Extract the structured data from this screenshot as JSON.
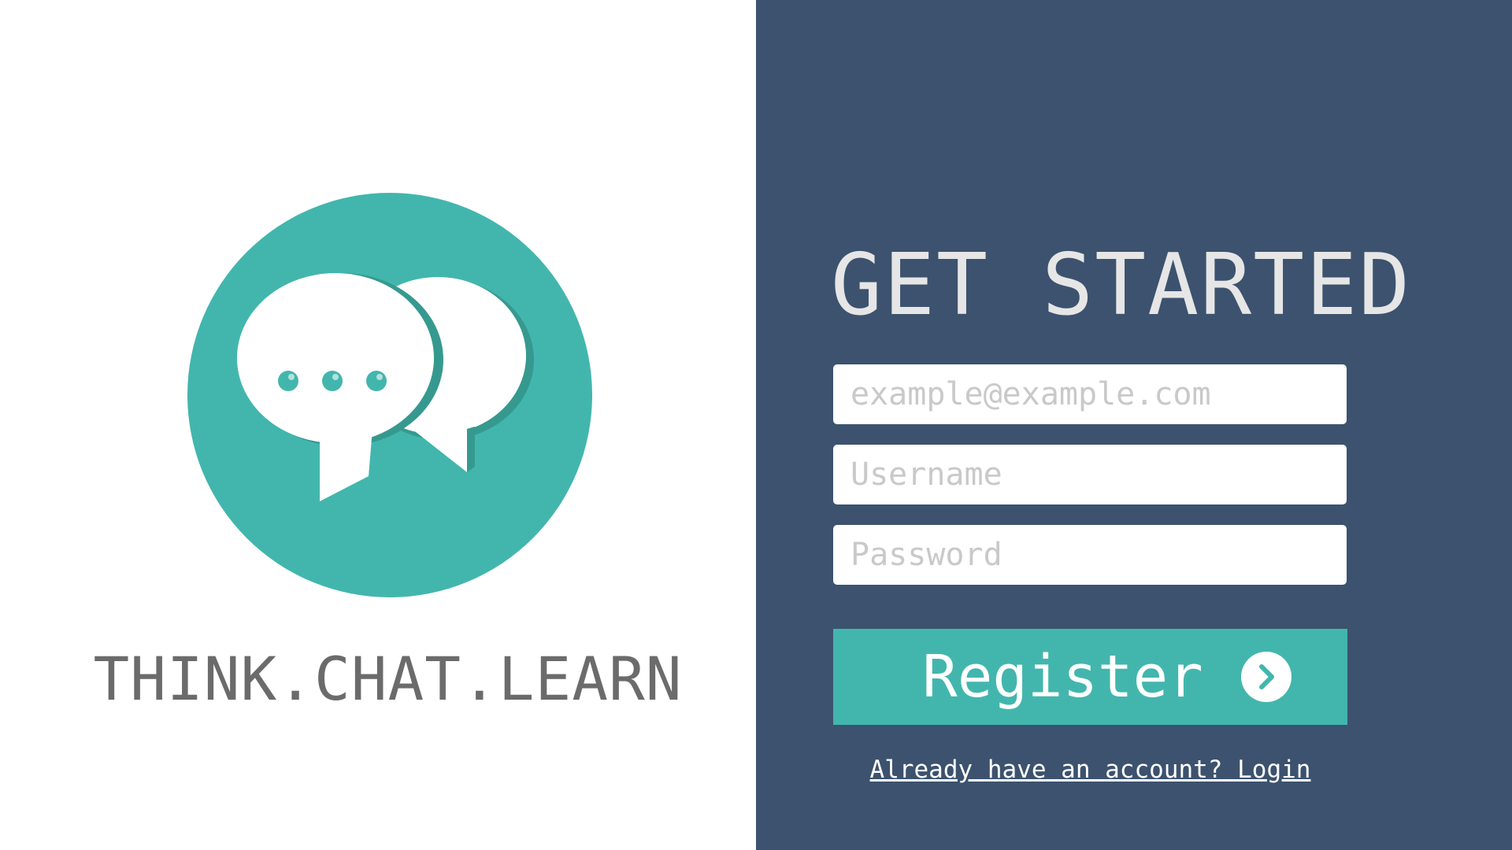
{
  "brand": {
    "tagline": "THINK.CHAT.LEARN",
    "logo_icon": "chat-bubbles-icon",
    "accent_color": "#42b6ad"
  },
  "form": {
    "title": "GET STARTED",
    "email_placeholder": "example@example.com",
    "username_placeholder": "Username",
    "password_placeholder": "Password",
    "register_label": "Register",
    "register_icon": "chevron-right-circle-icon",
    "login_link": "Already have an account? Login",
    "panel_color": "#3c526e"
  }
}
